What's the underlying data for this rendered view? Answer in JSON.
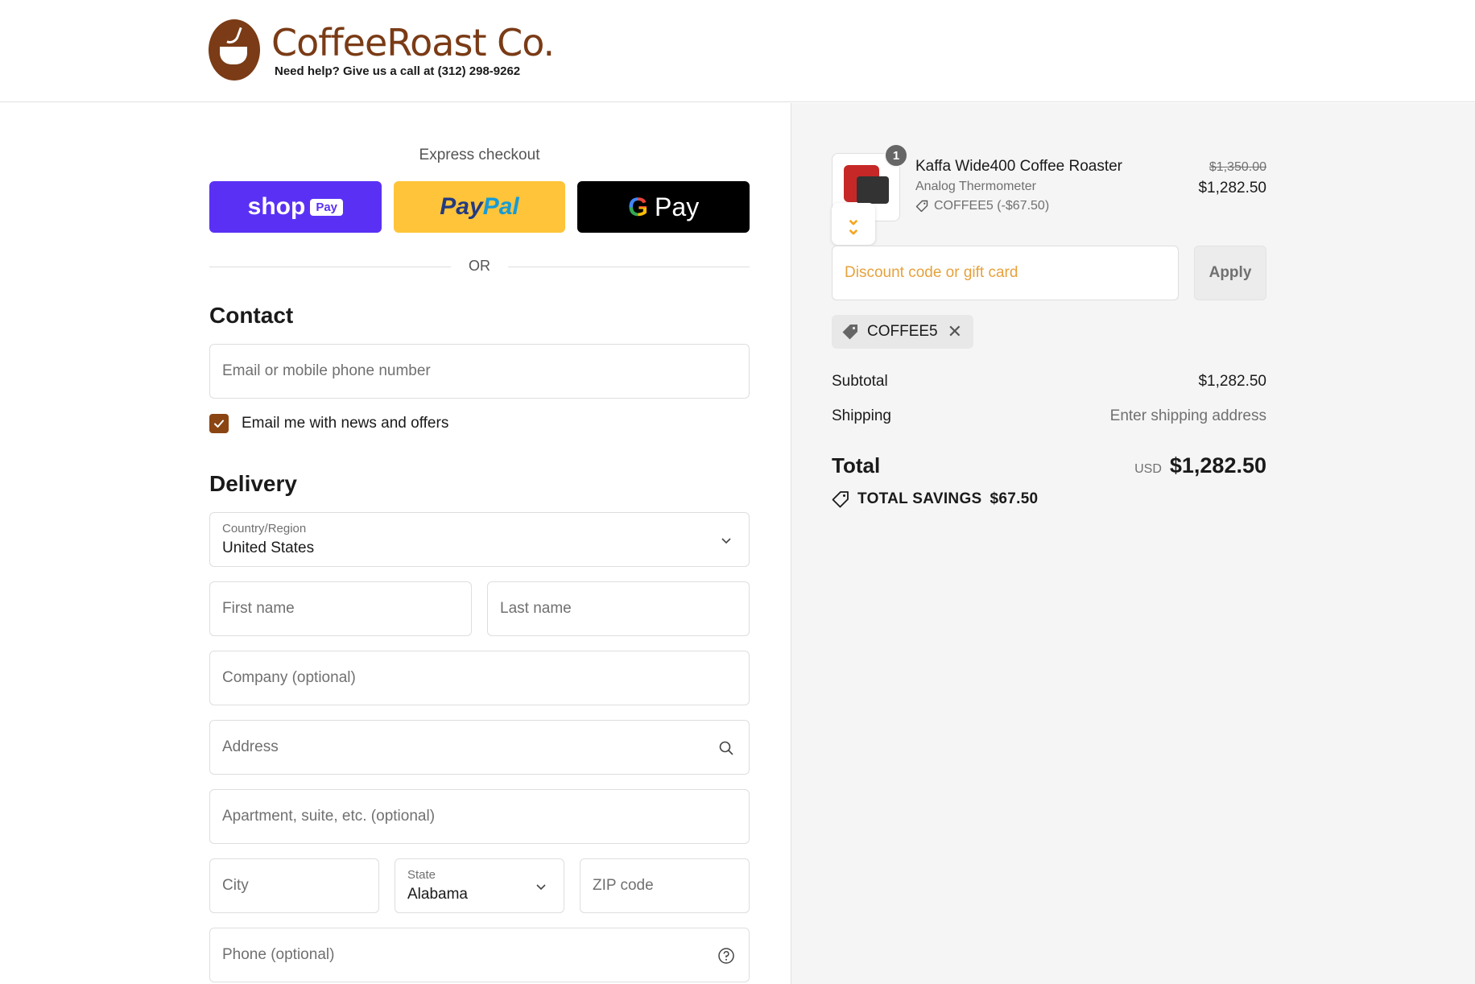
{
  "header": {
    "brand": "CoffeeRoast Co.",
    "help_text": "Need help? Give us a call at (312) 298-9262"
  },
  "express": {
    "title": "Express checkout",
    "shop_label": "shop",
    "shop_badge": "Pay",
    "paypal_part1": "Pay",
    "paypal_part2": "Pal",
    "gpay_g": "G",
    "gpay_label": "Pay",
    "or": "OR"
  },
  "contact": {
    "heading": "Contact",
    "email_placeholder": "Email or mobile phone number",
    "newsletter_label": "Email me with news and offers",
    "newsletter_checked": true
  },
  "delivery": {
    "heading": "Delivery",
    "country_label": "Country/Region",
    "country_value": "United States",
    "first_name": "First name",
    "last_name": "Last name",
    "company": "Company (optional)",
    "address": "Address",
    "apartment": "Apartment, suite, etc. (optional)",
    "city": "City",
    "state_label": "State",
    "state_value": "Alabama",
    "zip": "ZIP code",
    "phone": "Phone (optional)"
  },
  "order": {
    "quantity": "1",
    "product_name": "Kaffa Wide400 Coffee Roaster",
    "variant": "Analog Thermometer",
    "discount_line": "COFFEE5 (-$67.50)",
    "original_price": "$1,350.00",
    "price": "$1,282.50",
    "discount_placeholder": "Discount code or gift card",
    "apply_label": "Apply",
    "applied_code": "COFFEE5",
    "subtotal_label": "Subtotal",
    "subtotal_value": "$1,282.50",
    "shipping_label": "Shipping",
    "shipping_value": "Enter shipping address",
    "total_label": "Total",
    "currency": "USD",
    "total_value": "$1,282.50",
    "savings_label": "TOTAL SAVINGS",
    "savings_value": "$67.50"
  },
  "colors": {
    "brand": "#7a3b16",
    "shop_pay": "#5a31f4",
    "paypal": "#ffc439",
    "checkbox": "#8b4513",
    "discount_placeholder": "#e6a23c"
  }
}
